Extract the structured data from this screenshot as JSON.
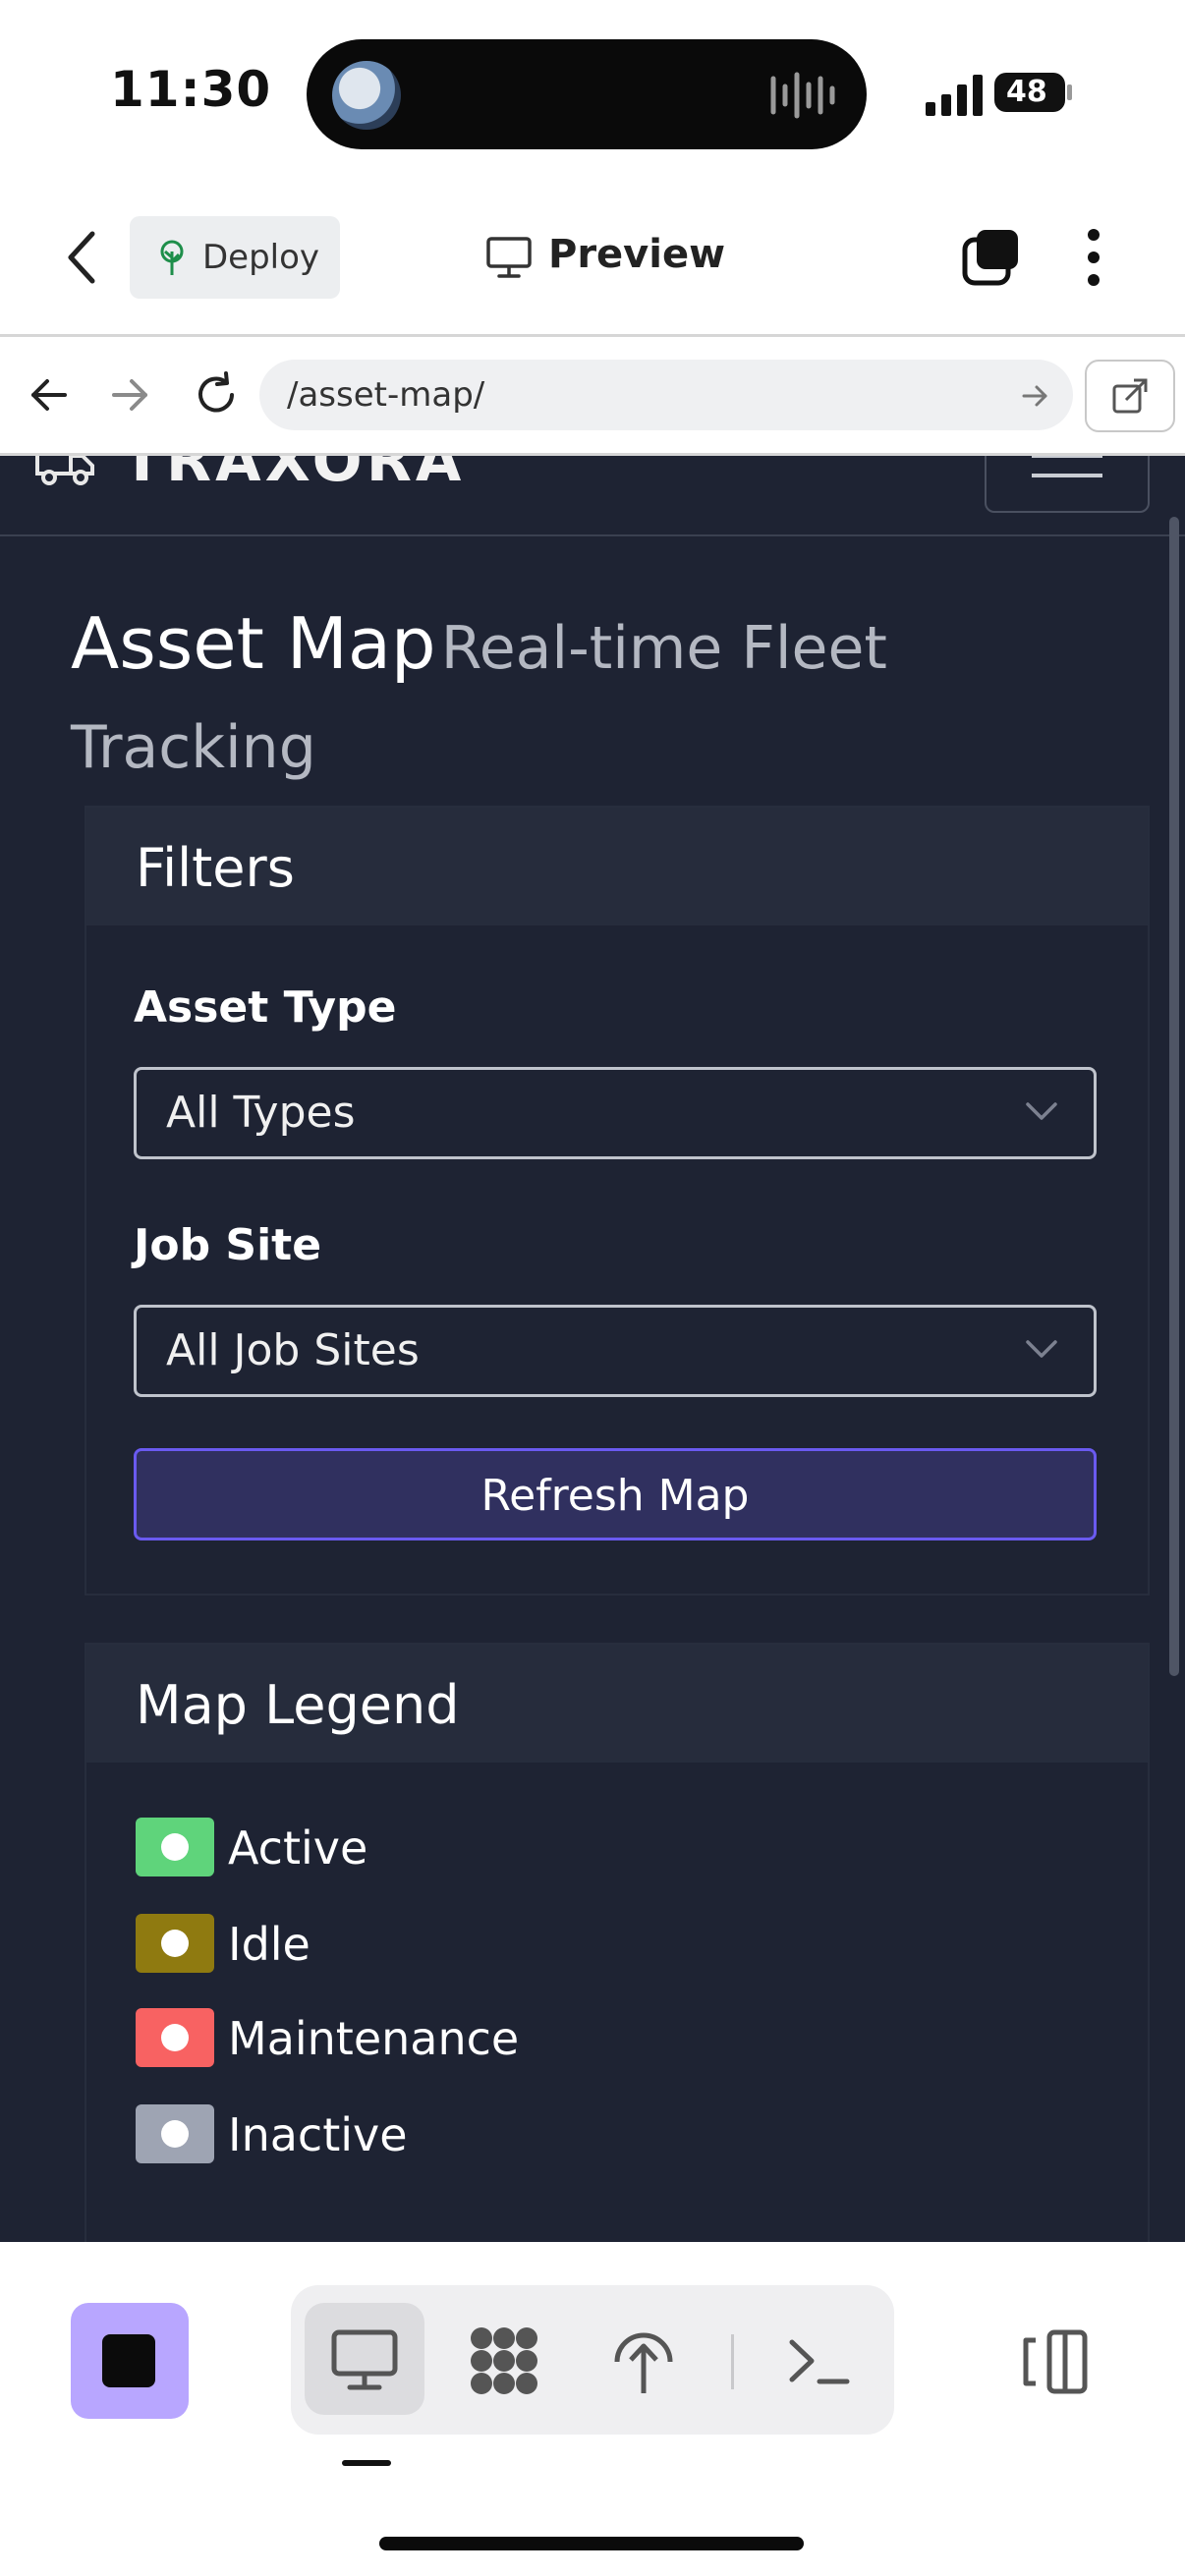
{
  "status_bar": {
    "time": "11:30",
    "battery": "48"
  },
  "app_header": {
    "deploy_label": "Deploy",
    "preview_label": "Preview"
  },
  "browser": {
    "url": "/asset-map/"
  },
  "site": {
    "brand": "TRAXORA"
  },
  "page": {
    "title": "Asset Map",
    "subtitle": "Real-time Fleet Tracking",
    "filters": {
      "title": "Filters",
      "asset_type_label": "Asset Type",
      "asset_type_value": "All Types",
      "job_site_label": "Job Site",
      "job_site_value": "All Job Sites",
      "refresh_label": "Refresh Map"
    },
    "legend": {
      "title": "Map Legend",
      "items": [
        {
          "label": "Active",
          "color": "#5fd47b"
        },
        {
          "label": "Idle",
          "color": "#8f7a10"
        },
        {
          "label": "Maintenance",
          "color": "#f86262"
        },
        {
          "label": "Inactive",
          "color": "#9ea4b3"
        }
      ]
    }
  },
  "colors": {
    "accent": "#6a5af0",
    "page_bg": "#1e2333",
    "stop_button": "#b8a6ff"
  }
}
